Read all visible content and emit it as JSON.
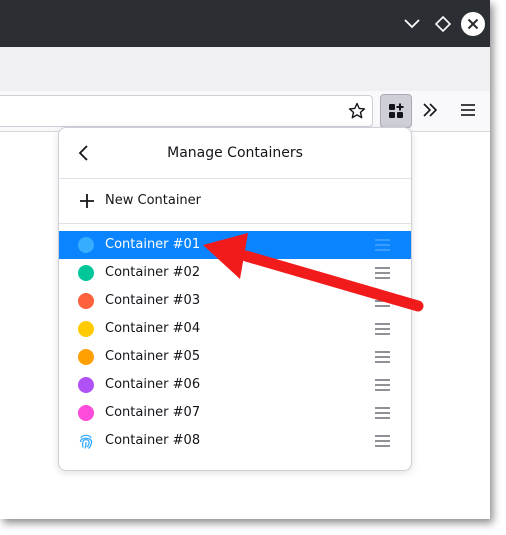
{
  "window": {
    "controls": [
      "chevron-down-icon",
      "diamond-icon",
      "close-icon"
    ]
  },
  "toolbar": {
    "bookmark_icon": "star-icon",
    "extension_icon": "containers-extension-icon",
    "overflow_icon": "chevron-double-right-icon",
    "menu_icon": "hamburger-menu-icon"
  },
  "panel": {
    "title": "Manage Containers",
    "new_container_label": "New Container",
    "containers": [
      {
        "label": "Container #01",
        "color": "#37adff",
        "icon": "circle",
        "selected": true
      },
      {
        "label": "Container #02",
        "color": "#00c79a",
        "icon": "circle",
        "selected": false
      },
      {
        "label": "Container #03",
        "color": "#ff613d",
        "icon": "circle",
        "selected": false
      },
      {
        "label": "Container #04",
        "color": "#ffcb00",
        "icon": "circle",
        "selected": false
      },
      {
        "label": "Container #05",
        "color": "#ff9f00",
        "icon": "circle",
        "selected": false
      },
      {
        "label": "Container #06",
        "color": "#af51f5",
        "icon": "circle",
        "selected": false
      },
      {
        "label": "Container #07",
        "color": "#ff4bda",
        "icon": "circle",
        "selected": false
      },
      {
        "label": "Container #08",
        "color": "#37adff",
        "icon": "fingerprint",
        "selected": false
      }
    ]
  },
  "colors": {
    "selection": "#0a84ff",
    "annotation_arrow": "#f21b1b",
    "titlebar": "#2b2e33"
  }
}
